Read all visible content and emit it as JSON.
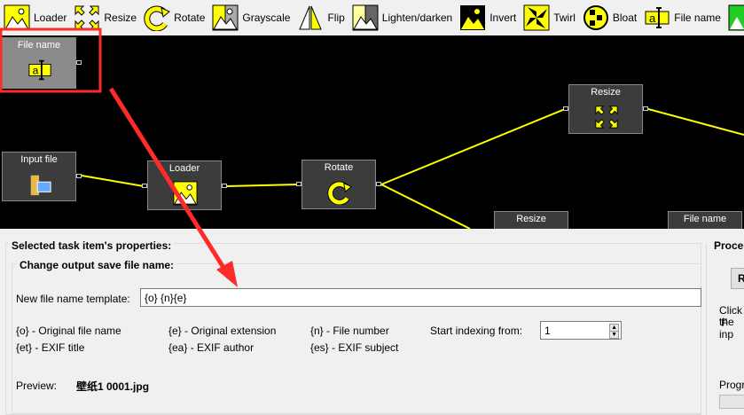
{
  "toolbar": {
    "items": [
      {
        "label": "Loader",
        "icon": "loader-icon"
      },
      {
        "label": "Resize",
        "icon": "resize-icon"
      },
      {
        "label": "Rotate",
        "icon": "rotate-icon"
      },
      {
        "label": "Grayscale",
        "icon": "grayscale-icon"
      },
      {
        "label": "Flip",
        "icon": "flip-icon"
      },
      {
        "label": "Lighten/darken",
        "icon": "lighten-darken-icon"
      },
      {
        "label": "Invert",
        "icon": "invert-icon"
      },
      {
        "label": "Twirl",
        "icon": "twirl-icon"
      },
      {
        "label": "Bloat",
        "icon": "bloat-icon"
      },
      {
        "label": "File name",
        "icon": "file-name-icon"
      }
    ]
  },
  "canvas": {
    "nodes": [
      {
        "title": "File name"
      },
      {
        "title": "Input file"
      },
      {
        "title": "Loader"
      },
      {
        "title": "Rotate"
      },
      {
        "title": "Resize"
      },
      {
        "title": "Resize"
      },
      {
        "title": "File name"
      }
    ]
  },
  "properties": {
    "title": "Selected task item's properties:",
    "group_title": "Change output save file name:",
    "template_label": "New file name template:",
    "template_value": "{o} {n}{e}",
    "hints": [
      "{o} - Original file name",
      "{e} - Original extension",
      "{n} - File number",
      "{et} - EXIF title",
      "{ea} - EXIF author",
      "{es} - EXIF subject"
    ],
    "start_label": "Start indexing from:",
    "start_value": "1",
    "preview_label": "Preview:",
    "preview_value": "壁纸1 0001.jpg"
  },
  "process": {
    "title": "Proce",
    "button": "R",
    "hint_line1": "Click 'F",
    "hint_line2": "the inp",
    "progress_label": "Progre"
  },
  "colors": {
    "accent": "#ffff00",
    "highlight": "#ff2a2a",
    "canvas": "#000000"
  }
}
